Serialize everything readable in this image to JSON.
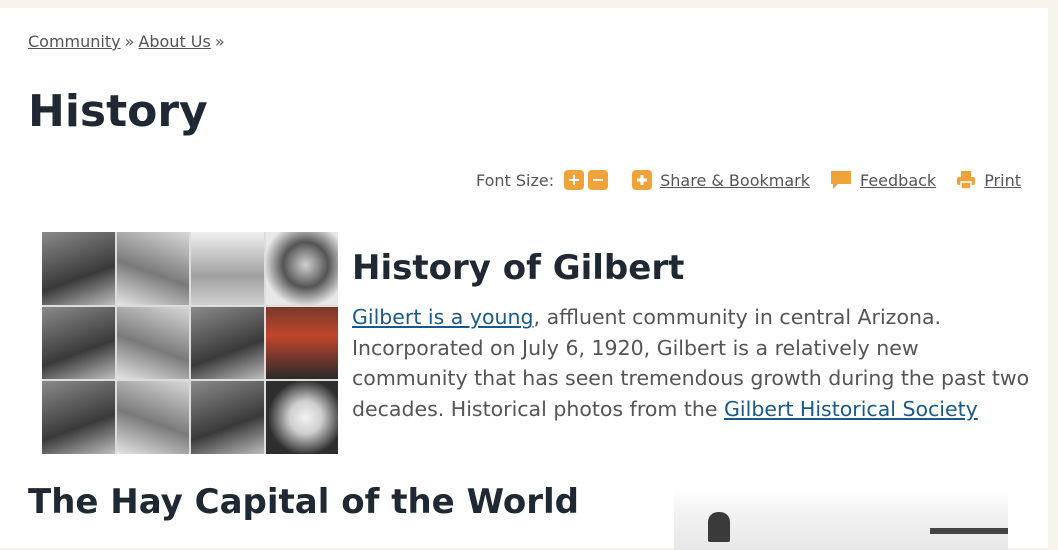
{
  "breadcrumb": {
    "items": [
      "Community",
      "About Us"
    ],
    "separator": "»"
  },
  "page_title": "History",
  "tools": {
    "font_size_label": "Font Size:",
    "increase_symbol": "+",
    "decrease_symbol": "−",
    "share_label": "Share & Bookmark",
    "feedback_label": "Feedback",
    "print_label": "Print",
    "accent_color": "#f0a33a"
  },
  "section": {
    "title": "History of Gilbert",
    "link1": "Gilbert is a young",
    "text1": ", affluent community in central Arizona. Incorporated on July 6, 1920, Gilbert is a relatively new community that has seen tremendous growth during the past two decades. Historical photos from the ",
    "link2": "Gilbert Historical Society"
  },
  "next_section": {
    "title": "The Hay Capital of the World"
  }
}
